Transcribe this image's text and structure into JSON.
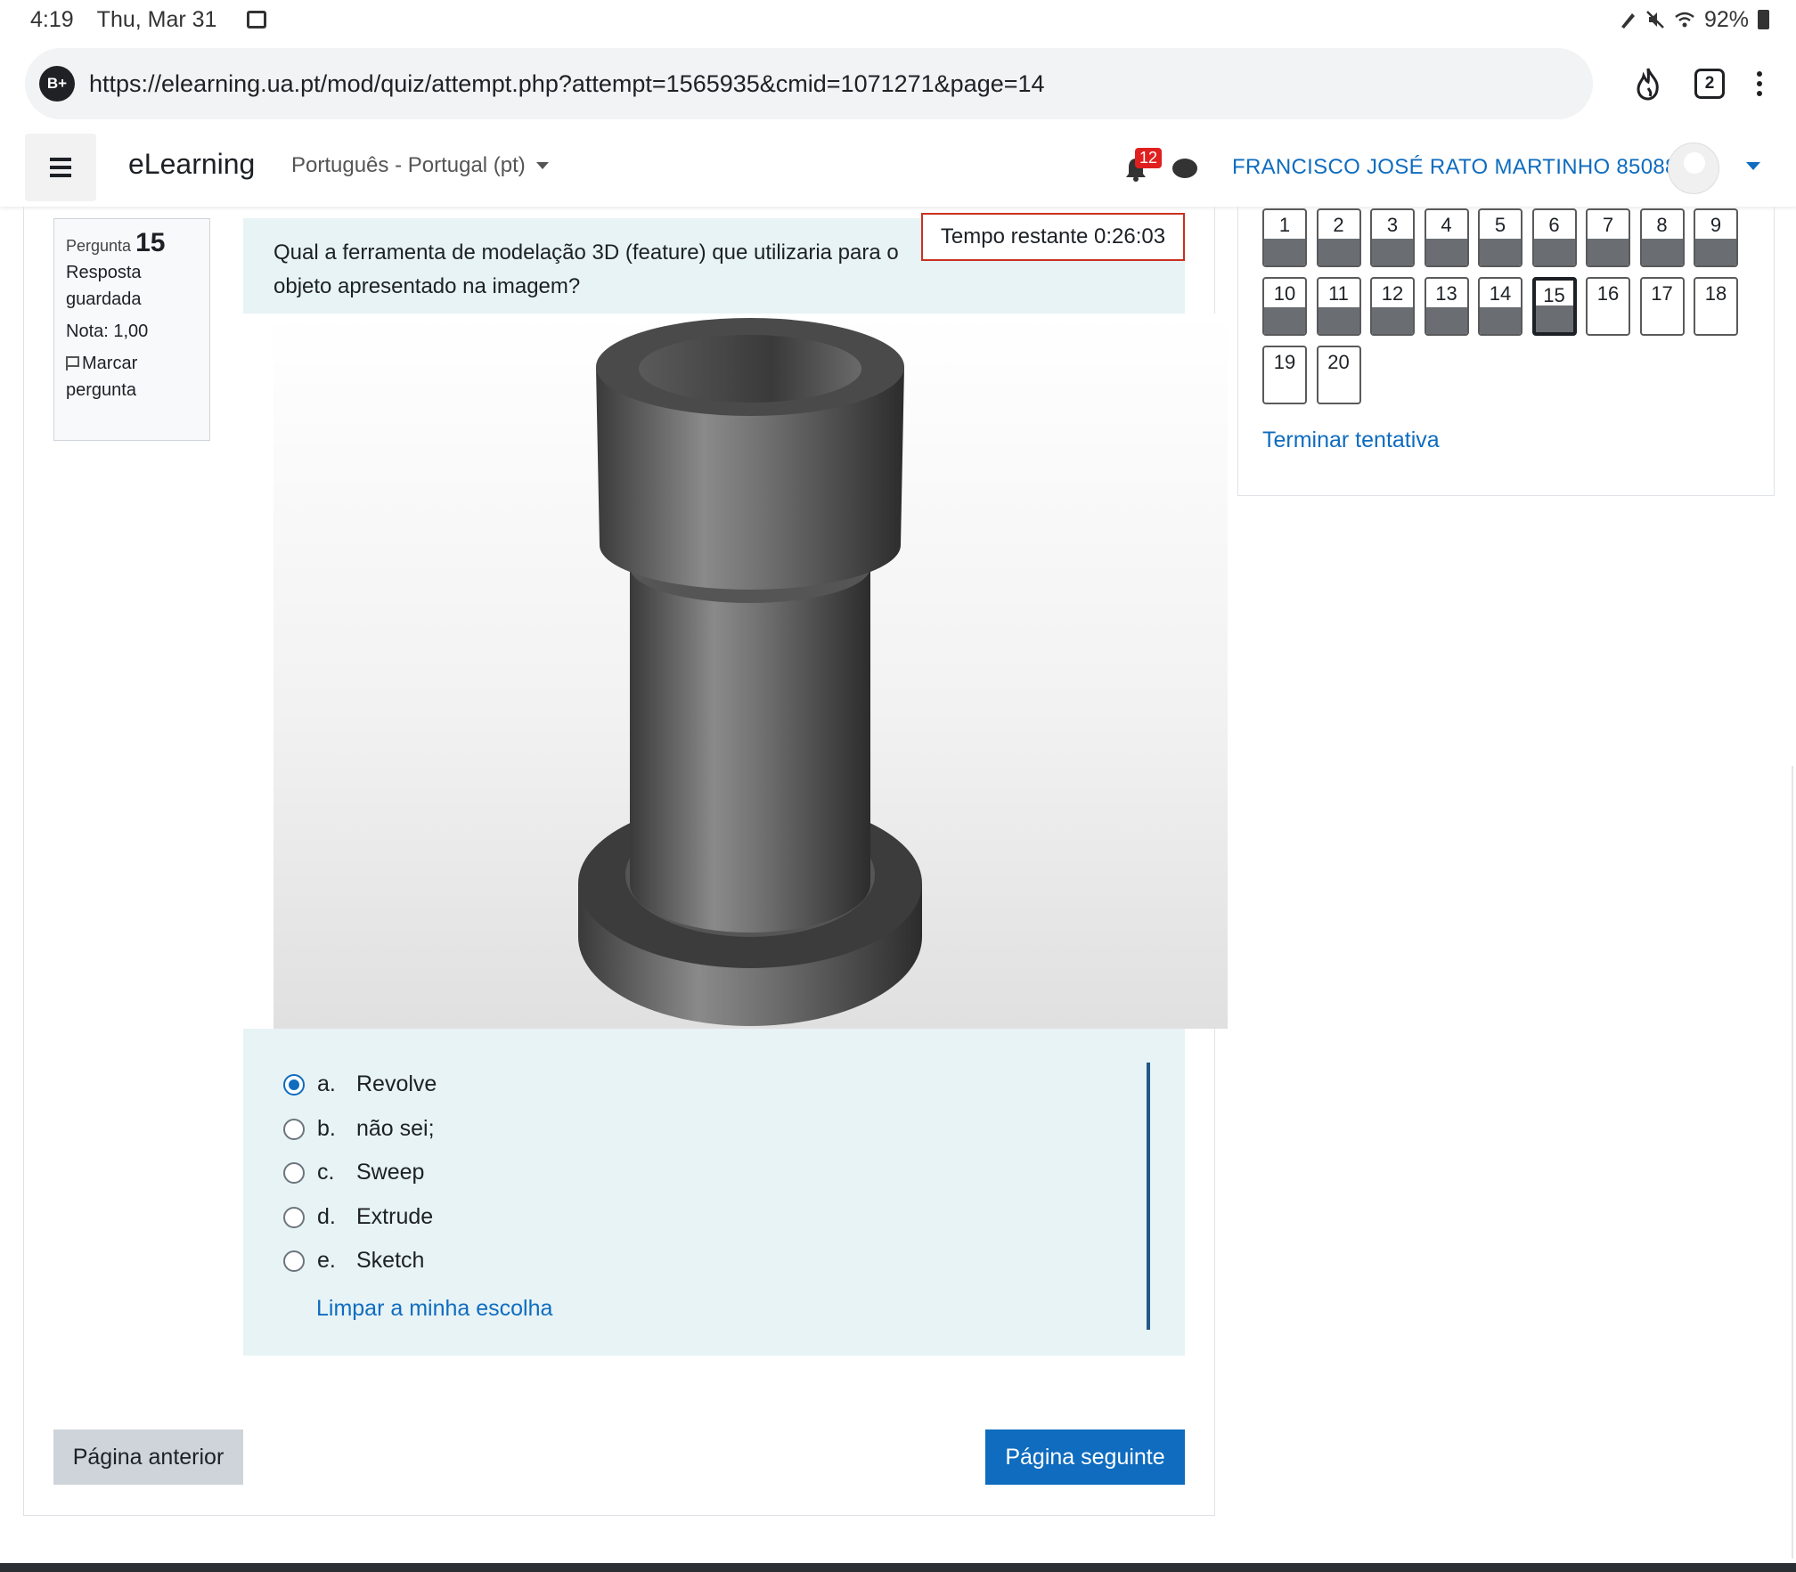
{
  "status_bar": {
    "time": "4:19",
    "date": "Thu, Mar 31",
    "battery": "92%"
  },
  "browser": {
    "url": "https://elearning.ua.pt/mod/quiz/attempt.php?attempt=1565935&cmid=1071271&page=14",
    "site_icon_label": "B+",
    "tab_count": "2",
    "icons": [
      "fire-icon",
      "tabs-icon",
      "menu-dots-icon"
    ]
  },
  "navbar": {
    "brand": "eLearning",
    "language": "Português - Portugal (pt)",
    "notification_count": "12",
    "user_name": "FRANCISCO JOSÉ RATO MARTINHO 85088"
  },
  "question_info": {
    "label": "Pergunta",
    "number": "15",
    "status": "Resposta guardada",
    "grade": "Nota: 1,00",
    "flag_label": "Marcar pergunta"
  },
  "timer": {
    "text": "Tempo restante 0:26:03"
  },
  "question": {
    "text": "Qual a ferramenta de modelação 3D (feature) que utilizaria para o",
    "text_line2": "objeto apresentado na imagem?",
    "image_icon": "3d-part-render"
  },
  "answers": [
    {
      "letter": "a.",
      "label": "Revolve",
      "selected": true
    },
    {
      "letter": "b.",
      "label": "não sei;",
      "selected": false
    },
    {
      "letter": "c.",
      "label": "Sweep",
      "selected": false
    },
    {
      "letter": "d.",
      "label": "Extrude",
      "selected": false
    },
    {
      "letter": "e.",
      "label": "Sketch",
      "selected": false
    }
  ],
  "clear_choice": "Limpar a minha escolha",
  "buttons": {
    "previous": "Página anterior",
    "next": "Página seguinte"
  },
  "quiz_navigation": {
    "questions": [
      "1",
      "2",
      "3",
      "4",
      "5",
      "6",
      "7",
      "8",
      "9",
      "10",
      "11",
      "12",
      "13",
      "14",
      "15",
      "16",
      "17",
      "18",
      "19",
      "20"
    ],
    "answered": [
      "1",
      "2",
      "3",
      "4",
      "5",
      "6",
      "7",
      "8",
      "9",
      "10",
      "11",
      "12",
      "13",
      "14",
      "15"
    ],
    "current": "15",
    "finish_label": "Terminar tentativa"
  },
  "colors": {
    "accent": "#0f6cbf",
    "question_bg": "#e7f3f5",
    "timer_border": "#ca3120",
    "notification_badge": "#e01f1f"
  }
}
